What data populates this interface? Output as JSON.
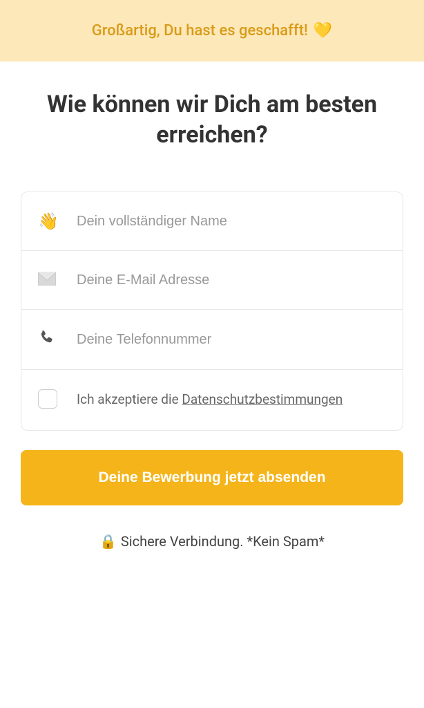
{
  "banner": {
    "text": "Großartig, Du hast es geschafft!",
    "heart": "💛"
  },
  "heading": "Wie können wir Dich am besten erreichen?",
  "form": {
    "name": {
      "icon": "👋",
      "placeholder": "Dein vollständiger Name"
    },
    "email": {
      "placeholder": "Deine E-Mail Adresse"
    },
    "phone": {
      "placeholder": "Deine Telefonnummer"
    },
    "privacy": {
      "prefix": "Ich akzeptiere die ",
      "link": "Datenschutzbestimmungen"
    }
  },
  "submit": {
    "label": "Deine Bewerbung jetzt absenden"
  },
  "footer": {
    "lock": "🔒",
    "text": "Sichere Verbindung. *Kein Spam*"
  },
  "colors": {
    "banner_bg": "#fce8b8",
    "banner_text": "#d99b1a",
    "submit_bg": "#f4b41a"
  }
}
